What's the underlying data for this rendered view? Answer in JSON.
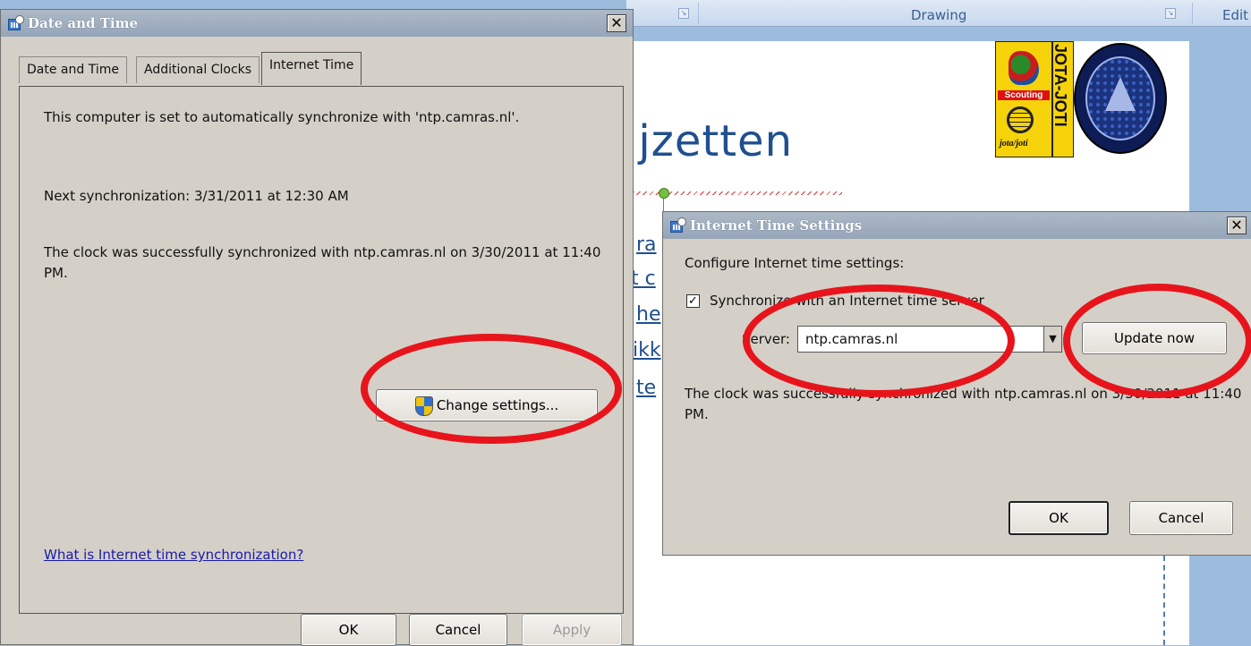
{
  "word_background": {
    "ribbon_groups": [
      "Drawing",
      "Edit"
    ],
    "heading": "ijzetten",
    "link_fragments": [
      "ra",
      "t c",
      "he",
      "ikk",
      "te"
    ],
    "logo_text": {
      "scouting": "Scouting",
      "jota_small": "jota/joti",
      "jota_joti_vertical": "JOTA-JOTI"
    }
  },
  "date_time_dialog": {
    "title": "Date and Time",
    "close_label": "✕",
    "tabs": [
      {
        "label": "Date and Time",
        "active": false
      },
      {
        "label": "Additional Clocks",
        "active": false
      },
      {
        "label": "Internet Time",
        "active": true
      }
    ],
    "auto_sync_text": "This computer is set to automatically synchronize with 'ntp.camras.nl'.",
    "next_sync_text": "Next synchronization: 3/31/2011 at 12:30 AM",
    "last_sync_text": "The clock was successfully synchronized with ntp.camras.nl on 3/30/2011 at 11:40 PM.",
    "change_settings_label": "Change settings...",
    "help_link": "What is Internet time synchronization?",
    "buttons": {
      "ok": "OK",
      "cancel": "Cancel",
      "apply": "Apply"
    }
  },
  "internet_time_dialog": {
    "title": "Internet Time Settings",
    "close_label": "✕",
    "configure_label": "Configure Internet time settings:",
    "sync_checkbox_label": "Synchronize with an Internet time server",
    "sync_checked": true,
    "server_label": "Server:",
    "server_value": "ntp.camras.nl",
    "update_now_label": "Update now",
    "status_text": "The clock was successfully synchronized with ntp.camras.nl on 3/30/2011 at 11:40 PM.",
    "buttons": {
      "ok": "OK",
      "cancel": "Cancel"
    }
  },
  "annotation_color": "#e8141c"
}
